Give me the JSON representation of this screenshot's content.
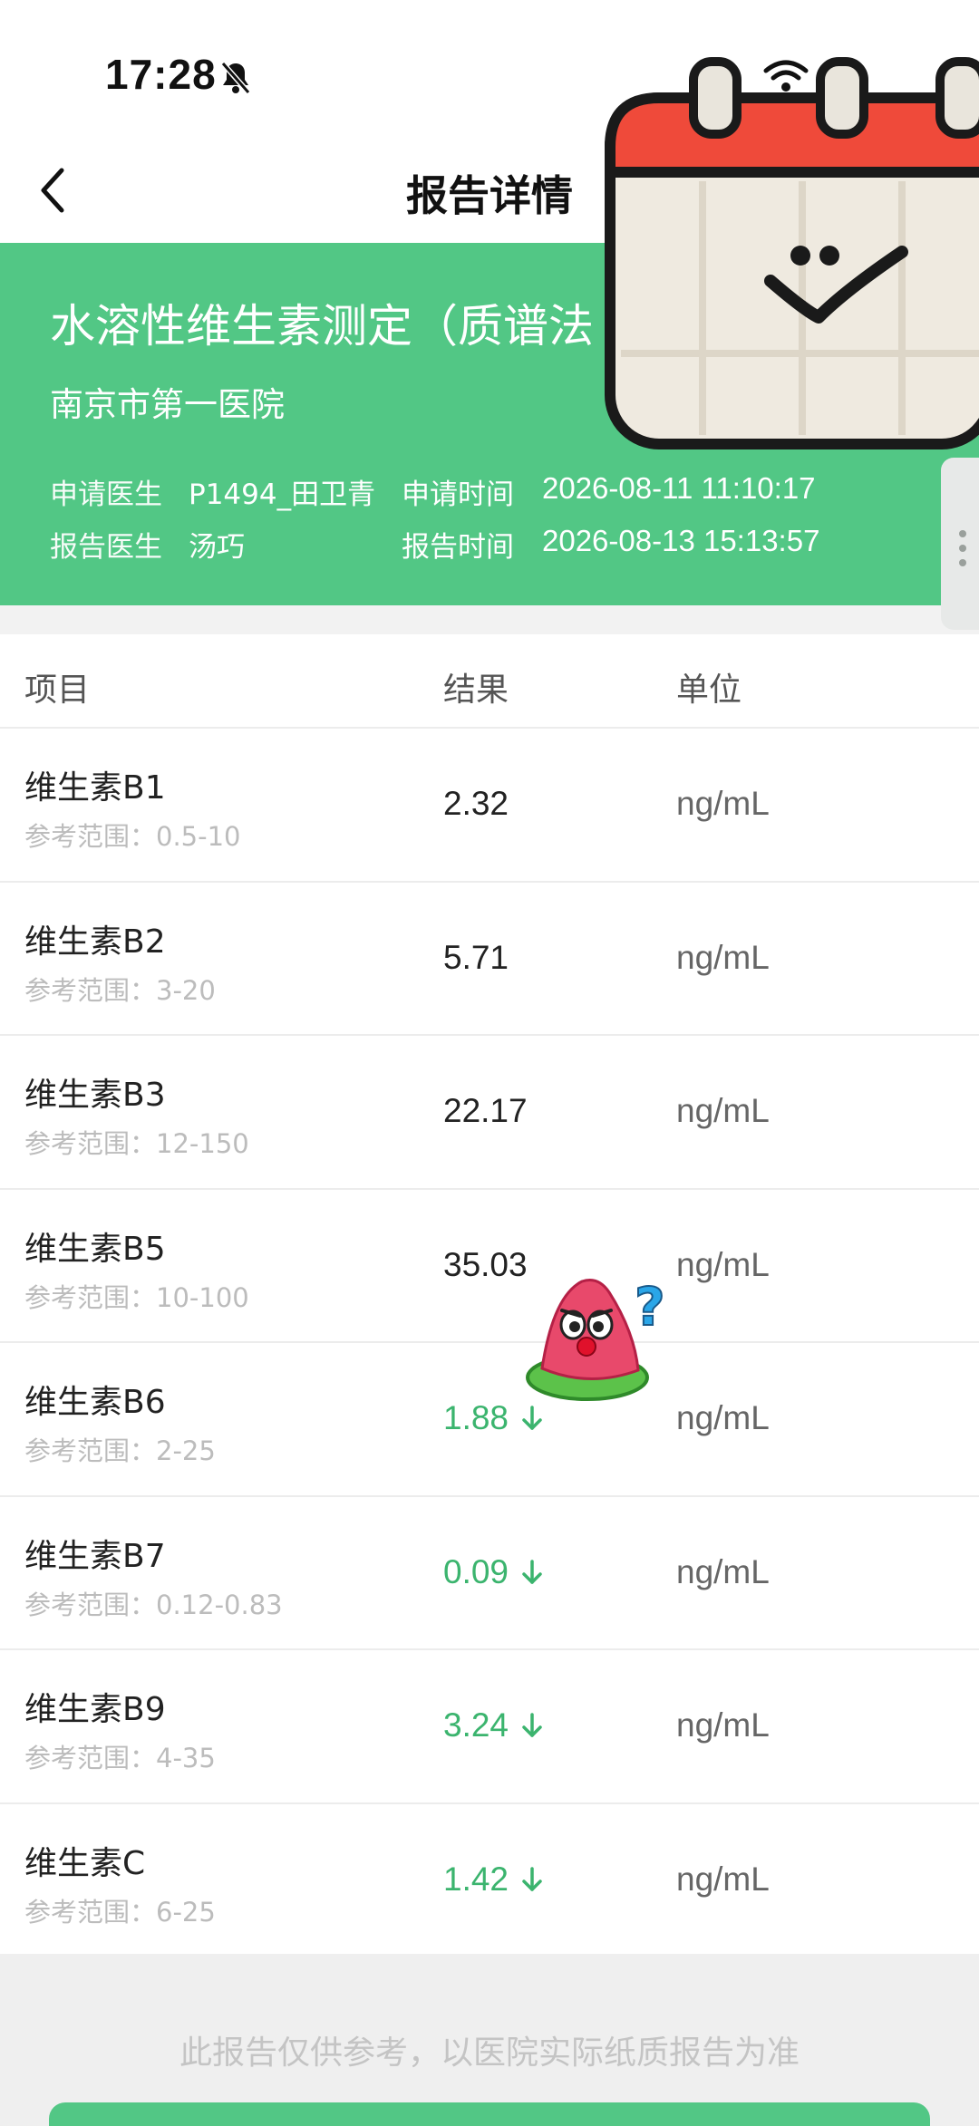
{
  "status_bar": {
    "time": "17:28"
  },
  "nav": {
    "title": "报告详情",
    "back_icon": "chevron-left-icon"
  },
  "report": {
    "title": "水溶性维生素测定（质谱法",
    "hospital": "南京市第一医院",
    "apply_doctor_label": "申请医生",
    "apply_doctor": "P1494_田卫青",
    "apply_time_label": "申请时间",
    "apply_time": "2026-08-11 11:10:17",
    "report_doctor_label": "报告医生",
    "report_doctor": "汤巧",
    "report_time_label": "报告时间",
    "report_time": "2026-08-13 15:13:57"
  },
  "table": {
    "headers": {
      "item": "项目",
      "result": "结果",
      "unit": "单位"
    },
    "rows": [
      {
        "name": "维生素B1",
        "ref": "参考范围：0.5-10",
        "result": "2.32",
        "unit": "ng/mL",
        "low": false
      },
      {
        "name": "维生素B2",
        "ref": "参考范围：3-20",
        "result": "5.71",
        "unit": "ng/mL",
        "low": false
      },
      {
        "name": "维生素B3",
        "ref": "参考范围：12-150",
        "result": "22.17",
        "unit": "ng/mL",
        "low": false
      },
      {
        "name": "维生素B5",
        "ref": "参考范围：10-100",
        "result": "35.03",
        "unit": "ng/mL",
        "low": false
      },
      {
        "name": "维生素B6",
        "ref": "参考范围：2-25",
        "result": "1.88",
        "unit": "ng/mL",
        "low": true
      },
      {
        "name": "维生素B7",
        "ref": "参考范围：0.12-0.83",
        "result": "0.09",
        "unit": "ng/mL",
        "low": true
      },
      {
        "name": "维生素B9",
        "ref": "参考范围：4-35",
        "result": "3.24",
        "unit": "ng/mL",
        "low": true
      },
      {
        "name": "维生素C",
        "ref": "参考范围：6-25",
        "result": "1.42",
        "unit": "ng/mL",
        "low": true
      }
    ]
  },
  "footer": {
    "disclaimer": "此报告仅供参考，以医院实际纸质报告为准"
  },
  "colors": {
    "brand_green": "#52c785",
    "low_value": "#3bb46e"
  }
}
